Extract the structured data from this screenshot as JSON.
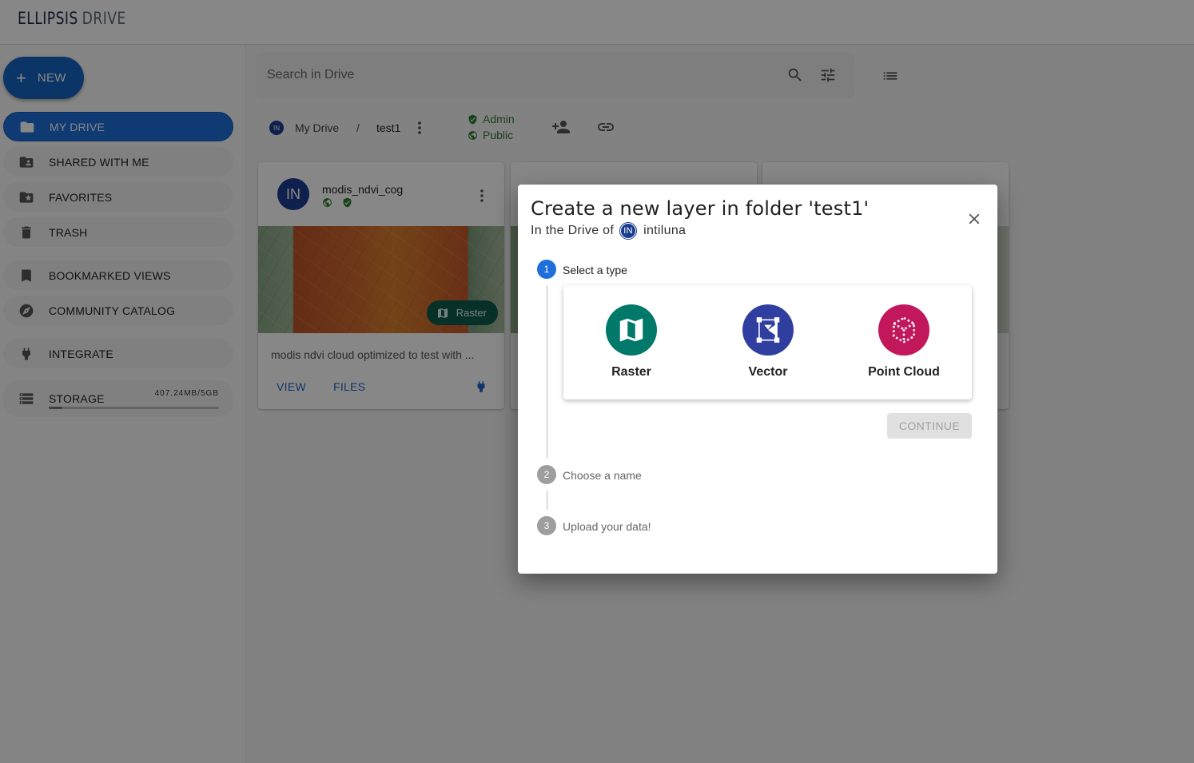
{
  "app": {
    "logo_main": "ELLIPSIS",
    "logo_sub": "DRIVE"
  },
  "sidebar": {
    "new_label": "NEW",
    "items": [
      {
        "label": "MY DRIVE",
        "icon": "folder-icon",
        "active": true
      },
      {
        "label": "SHARED WITH ME",
        "icon": "shared-folder-icon"
      },
      {
        "label": "FAVORITES",
        "icon": "star-folder-icon"
      },
      {
        "label": "TRASH",
        "icon": "trash-icon"
      },
      {
        "label": "BOOKMARKED VIEWS",
        "icon": "bookmark-icon"
      },
      {
        "label": "COMMUNITY CATALOG",
        "icon": "compass-icon"
      },
      {
        "label": "INTEGRATE",
        "icon": "plug-icon"
      }
    ],
    "storage": {
      "label": "STORAGE",
      "size": "407.24MB/5GB",
      "used_fraction": 0.08
    }
  },
  "search": {
    "placeholder": "Search in Drive"
  },
  "breadcrumb": {
    "avatar": "IN",
    "root": "My Drive",
    "separator": "/",
    "current": "test1"
  },
  "access": {
    "role": "Admin",
    "visibility": "Public"
  },
  "cards": [
    {
      "avatar": "IN",
      "title": "modis_ndvi_cog",
      "type_chip": "Raster",
      "description": "modis ndvi cloud optimized to test with ...",
      "view_label": "VIEW",
      "files_label": "FILES"
    }
  ],
  "modal": {
    "title": "Create a new layer in folder 'test1'",
    "subtitle_prefix": "In the Drive of",
    "owner_avatar": "IN",
    "owner": "intiluna",
    "steps": [
      {
        "num": "1",
        "label": "Select a type",
        "active": true
      },
      {
        "num": "2",
        "label": "Choose a name",
        "active": false
      },
      {
        "num": "3",
        "label": "Upload your data!",
        "active": false
      }
    ],
    "types": [
      {
        "label": "Raster",
        "color": "#00796b",
        "icon": "map-icon"
      },
      {
        "label": "Vector",
        "color": "#303f9f",
        "icon": "polygon-icon"
      },
      {
        "label": "Point Cloud",
        "color": "#c2185b",
        "icon": "cube-icon"
      }
    ],
    "continue_label": "CONTINUE"
  }
}
